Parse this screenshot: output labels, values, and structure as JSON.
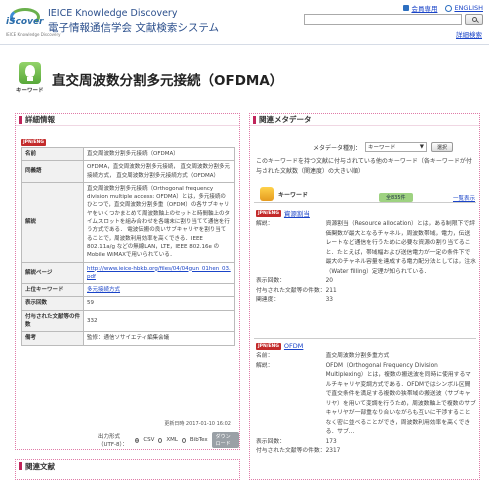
{
  "header": {
    "logo_word": "iScover",
    "logo_sub": "IEICE Knowledge Discovery",
    "title_en": "IEICE Knowledge Discovery",
    "title_ja": "電子情報通信学会 文献検索システム",
    "member_link": "会員専用",
    "english_link": "ENGLISH",
    "search_placeholder": "",
    "help_link": "詳細検索"
  },
  "keyword": {
    "badge_label": "キーワード",
    "title": "直交周波数分割多元接続（OFDMA）"
  },
  "detail_panel": {
    "heading": "詳細情報",
    "lang_badge": "JPN/ENG",
    "rows": [
      {
        "key": "名前",
        "value": "直交周波数分割多元接続（OFDMA）"
      },
      {
        "key": "同義語",
        "value": "OFDMA，直交周波数分割多元接続， 直交周波数分割多元接続方式， 直交周波数分割多元接続方式（OFDMA）"
      },
      {
        "key": "解説",
        "value": "直交周波数分割多元接続（Orthogonal frequency division multiple access: OFDMA）とは，多元接続のひとつで，直交周波数分割多重（OFDM）の各サブキャリヤをいくつかまとめて周波数軸上のセットと時間軸上のタイムスロットを組み合わせを各端末に割り当てて通信を行う方式である． 電波伝搬の良いサブキャリヤを割り当てることで，周波数利用効率を高くできる．IEEE 802.11a/g などの無線LAN，LTE，IEEE 802.16e の Mobile WiMAXで用いられている．"
      },
      {
        "key": "解説ページ",
        "value": "http://www.ieice-hbkb.org/files/04/04gun_01hen_03.pdf"
      },
      {
        "key": "上位キーワード",
        "value": "多元接続方式"
      },
      {
        "key": "表示回数",
        "value": "59"
      },
      {
        "key": "付与された文献等の件数",
        "value": "332"
      },
      {
        "key": "備考",
        "value": "監修：通信ソサイエティ編集会議"
      }
    ],
    "updated": "更新日時 2017-01-10 16:02",
    "export_label": "出力形式（UTF-8）：",
    "export_csv": "CSV",
    "export_xml": "XML",
    "export_bibtex": "BibTex",
    "download_label": "ダウンロード"
  },
  "related_docs_panel": {
    "heading": "関連文献"
  },
  "meta_panel": {
    "heading": "関連メタデータ",
    "type_label": "メタデータ種別：",
    "type_value": "キーワード",
    "select_button": "選択",
    "description": "このキーワードを持つ文献に付与されている他のキーワード（各キーワードが付与された文献数（関連度）の大きい順）",
    "kw_label": "キーワード",
    "count_badge": "全835件",
    "list_link": "一覧表示",
    "entries": [
      {
        "lang": "JPN/ENG",
        "name": "資源割当",
        "fields": [
          {
            "k": "解説：",
            "v": "資源割当（Resource allocation）とは，ある制限下で評価関数が最大となるチャネル，周波数帯域，電力，伝送レートなど通信を行うために必要な資源の割り当てること．たとえば，帯域幅および送信電力が一定の条件下で最大のチャネル容量を達成する電力配分法としては，注水（Water filling）定理が知られている．"
          },
          {
            "k": "表示回数：",
            "v": "20"
          },
          {
            "k": "付与された文献等の件数：",
            "v": "211"
          },
          {
            "k": "関連度：",
            "v": "33"
          }
        ]
      },
      {
        "lang": "JPN/ENG",
        "name": "OFDM",
        "fields": [
          {
            "k": "名前：",
            "v": "直交周波数分割多重方式"
          },
          {
            "k": "解説：",
            "v": "OFDM（Orthogonal Frequency Division Multiplexing）とは，複数の搬送波を同時に使用するマルチキャリヤ変調方式である．OFDMではシンボル区間で直交条件を満足する複数の狭帯域の搬送波（サブキャリヤ）を用いて変調を行うため，周波数軸上で複数のサブキャリヤが一部重なり合いながらも互いに干渉することなく密に並べることができ，周波数利用効率を高くできる．サブ..."
          },
          {
            "k": "表示回数：",
            "v": "173"
          },
          {
            "k": "付与された文献等の件数：",
            "v": "2317"
          }
        ]
      }
    ]
  }
}
